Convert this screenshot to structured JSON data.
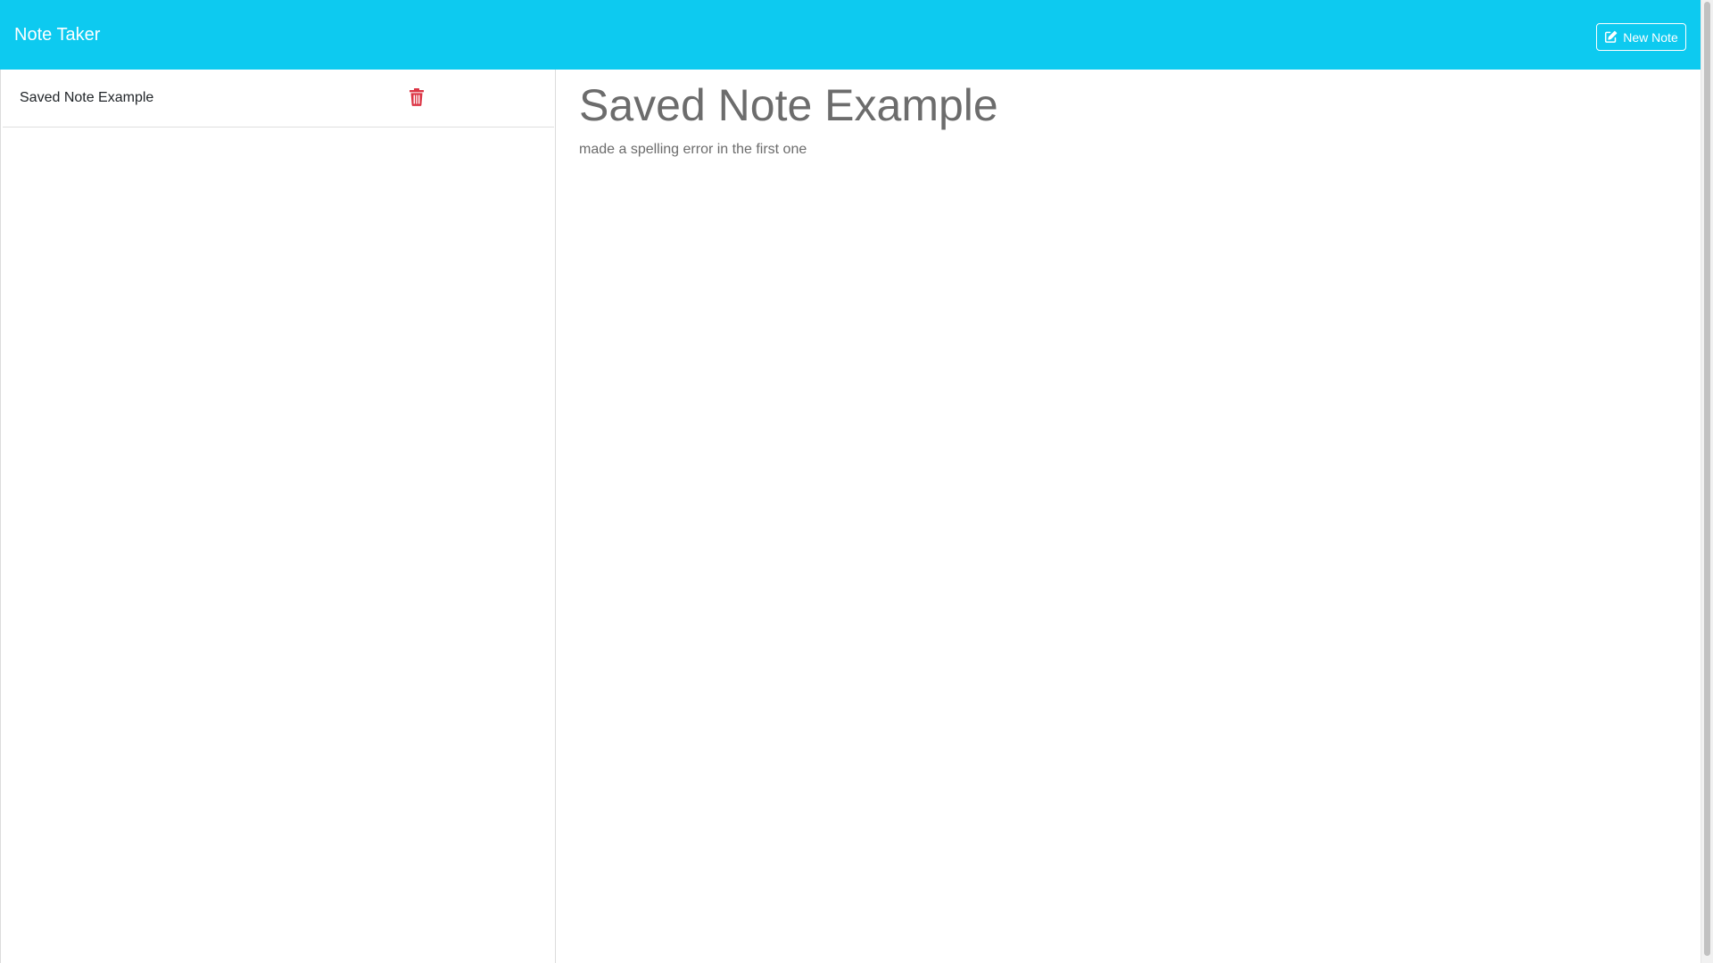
{
  "header": {
    "brand": "Note Taker",
    "new_note_label": "New Note",
    "background_color": "#0dcaf0",
    "icon": "edit-icon"
  },
  "sidebar": {
    "notes": [
      {
        "title": "Saved Note Example",
        "delete_icon": "trash-icon",
        "delete_icon_color": "#dc3545"
      }
    ]
  },
  "main": {
    "note_title": "Saved Note Example",
    "note_text": "made a spelling error in the first one"
  }
}
